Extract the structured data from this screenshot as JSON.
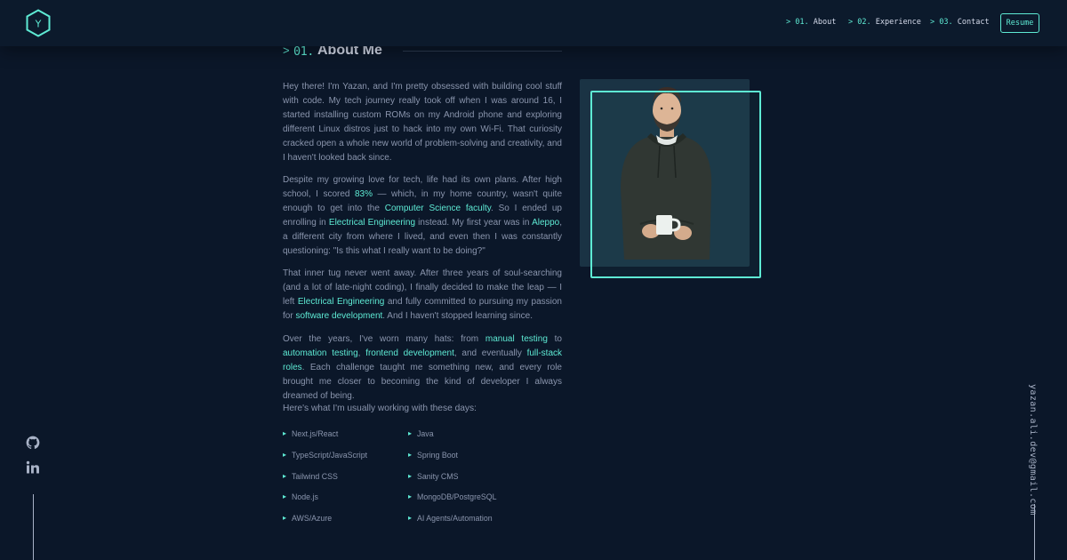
{
  "nav": {
    "logo_letter": "Y",
    "items": [
      {
        "num": "01.",
        "label": "About"
      },
      {
        "num": "02.",
        "label": "Experience"
      },
      {
        "num": "03.",
        "label": "Contact"
      }
    ],
    "resume_label": "Resume"
  },
  "side": {
    "email": "yazan.ali.dev@gmail.com",
    "icons": [
      "github-icon",
      "linkedin-icon"
    ]
  },
  "about": {
    "arrow": ">",
    "number": "01.",
    "title": "About Me",
    "p1": "Hey there! I'm Yazan, and I'm pretty obsessed with building cool stuff with code. My tech journey really took off when I was around 16, I started installing custom ROMs on my Android phone and exploring different Linux distros just to hack into my own Wi-Fi. That curiosity cracked open a whole new world of problem-solving and creativity, and I haven't looked back since.",
    "p2": {
      "t1": "Despite my growing love for tech, life had its own plans. After high school, I scored ",
      "h1": "83%",
      "t2": " — which, in my home country, wasn't quite enough to get into the ",
      "h2": "Computer Science faculty",
      "t3": ". So I ended up enrolling in ",
      "h3": "Electrical Engineering",
      "t4": " instead. My first year was in ",
      "h4": "Aleppo",
      "t5": ", a different city from where I lived, and even then I was constantly questioning: \"Is this what I really want to be doing?\""
    },
    "p3": {
      "t1": "That inner tug never went away. After three years of soul-searching (and a lot of late-night coding), I finally decided to make the leap — I left ",
      "h1": "Electrical Engineering",
      "t2": " and fully committed to pursuing my passion for ",
      "h2": "software development",
      "t3": ". And I haven't stopped learning since."
    },
    "p4": {
      "t1": "Over the years, I've worn many hats: from ",
      "h1": "manual testing",
      "t2": " to ",
      "h2": "automation testing",
      "t3": ", ",
      "h3": "frontend development",
      "t4": ", and eventually ",
      "h4": "full-stack roles",
      "t5": ". Each challenge taught me something new, and every role brought me closer to becoming the kind of developer I always dreamed of being."
    },
    "usual": "Here's what I'm usually working with these days:",
    "tech_left": [
      "Next.js/React",
      "TypeScript/JavaScript",
      "Tailwind CSS",
      "Node.js",
      "AWS/Azure"
    ],
    "tech_right": [
      "Java",
      "Spring Boot",
      "Sanity CMS",
      "MongoDB/PostgreSQL",
      "AI Agents/Automation"
    ]
  },
  "colors": {
    "background": "#0b1729",
    "accent": "#5eead4",
    "text": "#8a95ad",
    "heading": "#d6dcec"
  }
}
